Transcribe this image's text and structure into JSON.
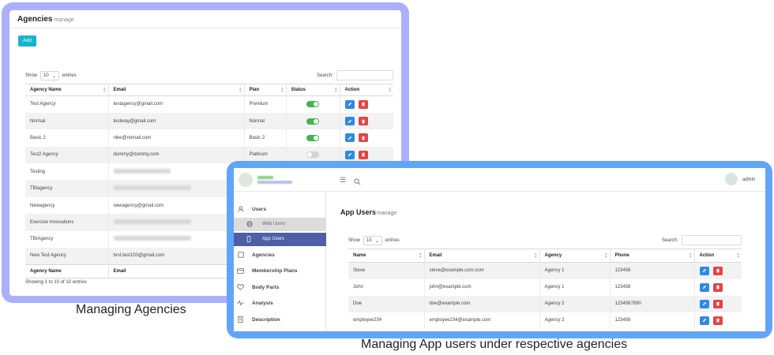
{
  "agencies_panel": {
    "title": "Agencies",
    "subtitle": "manage",
    "add_label": "Add",
    "show_label": "Show",
    "entries_value": "10",
    "entries_label": "entries",
    "search_label": "Search:",
    "columns": [
      "Agency Name",
      "Email",
      "Plan",
      "Status",
      "Action"
    ],
    "rows": [
      {
        "name": "Test Agency",
        "email": "testagency@gmail.com",
        "plan": "Premium",
        "status": "on"
      },
      {
        "name": "Normal",
        "email": "testway@gmail.com",
        "plan": "Normal",
        "status": "on"
      },
      {
        "name": "Basic 2",
        "email": "nike@nomail.com",
        "plan": "Basic 2",
        "status": "on"
      },
      {
        "name": "Test2 Agency",
        "email": "dummy@dummy.com",
        "plan": "Platinum",
        "status": "off"
      },
      {
        "name": "Testing",
        "email": "",
        "plan": "",
        "status": ""
      },
      {
        "name": "TBlagency",
        "email": "",
        "plan": "",
        "status": ""
      },
      {
        "name": "Newagency",
        "email": "newagency@gmail.com",
        "plan": "",
        "status": ""
      },
      {
        "name": "Exercise Innovations",
        "email": "",
        "plan": "",
        "status": ""
      },
      {
        "name": "TBIAgency",
        "email": "",
        "plan": "",
        "status": ""
      },
      {
        "name": "New Test Agency",
        "email": "brst.test100@gmail.com",
        "plan": "",
        "status": ""
      }
    ],
    "footer_columns": [
      "Agency Name",
      "Email"
    ],
    "info": "Showing 1 to 10 of 10 entries",
    "caption": "Managing Agencies"
  },
  "app_users_panel": {
    "user_label": "admin",
    "sidebar": {
      "users": "Users",
      "web_users": "Web Users",
      "app_users": "App Users",
      "agencies": "Agencies",
      "membership_plans": "Membership Plans",
      "body_parts": "Body Parts",
      "analysis": "Analysis",
      "description": "Description"
    },
    "title": "App Users",
    "subtitle": "manage",
    "show_label": "Show",
    "entries_value": "10",
    "entries_label": "entries",
    "search_label": "Search:",
    "columns": [
      "Name",
      "Email",
      "Agency",
      "Phone",
      "Action"
    ],
    "rows": [
      {
        "name": "Steve",
        "email": "steve@example.com.com",
        "agency": "Agency 1",
        "phone": "123456"
      },
      {
        "name": "John",
        "email": "john@example.com",
        "agency": "Agency 1",
        "phone": "123456"
      },
      {
        "name": "Doe",
        "email": "doe@example.com",
        "agency": "Agency 2",
        "phone": "1234567890"
      },
      {
        "name": "employee234",
        "email": "employee234@example.com",
        "agency": "Agency 2",
        "phone": "123456"
      }
    ],
    "caption": "Managing App users under respective agencies"
  },
  "colors": {
    "agencies_frame": "#aab0fb",
    "app_users_frame": "#62a5f8",
    "add_button": "#17b4cf",
    "edit_button": "#2f8be0",
    "delete_button": "#e14545",
    "toggle_on": "#43b44e",
    "sidebar_active": "#4e5fa5"
  }
}
